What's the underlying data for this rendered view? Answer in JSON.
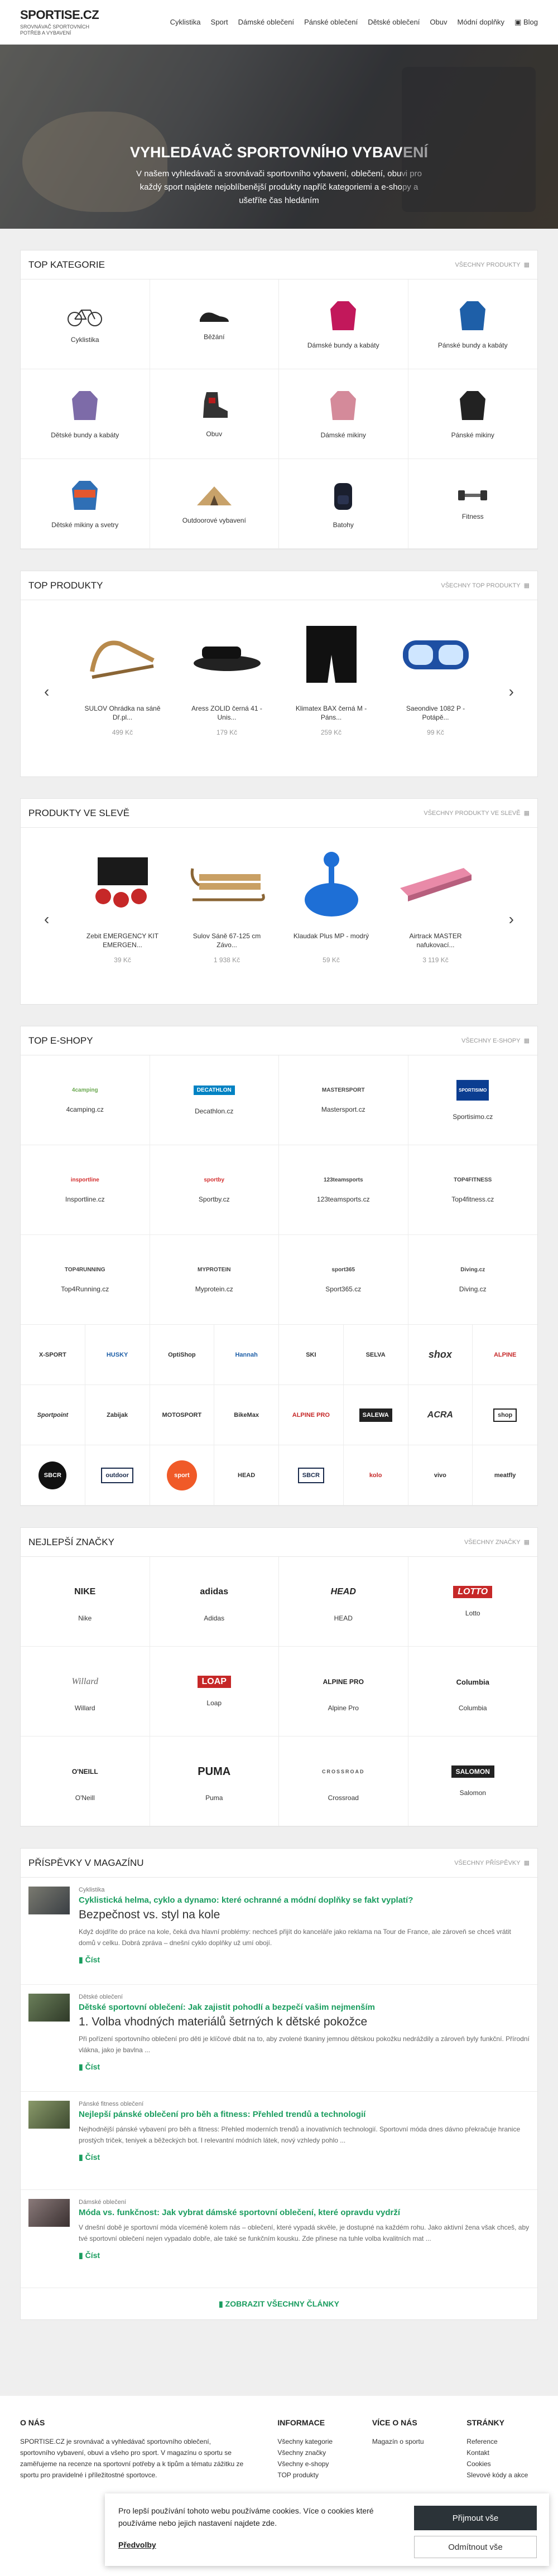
{
  "header": {
    "logo_title": "SPORTISE.CZ",
    "logo_sub_1": "SROVNÁVAČ SPORTOVNÍCH",
    "logo_sub_2": "POTŘEB A VYBAVENÍ",
    "nav": [
      "Cyklistika",
      "Sport",
      "Dámské oblečení",
      "Pánské oblečení",
      "Dětské oblečení",
      "Obuv",
      "Módní doplňky",
      "Blog"
    ]
  },
  "hero": {
    "title": "VYHLEDÁVAČ SPORTOVNÍHO VYBAVENÍ",
    "text": "V našem vyhledávači a srovnávači sportovního vybavení, oblečení, obuvi pro každý sport najdete nejoblíbenější produkty napříč kategoriemi a e-shopy a ušetříte čas hledáním"
  },
  "categories": {
    "title": "TOP KATEGORIE",
    "link": "VŠECHNY PRODUKTY",
    "items": [
      "Cyklistika",
      "Běžání",
      "Dámské bundy a kabáty",
      "Pánské bundy a kabáty",
      "Dětské bundy a kabáty",
      "Obuv",
      "Dámské mikiny",
      "Pánské mikiny",
      "Dětské mikiny a svetry",
      "Outdoorové vybavení",
      "Batohy",
      "Fitness"
    ]
  },
  "top_products": {
    "title": "TOP PRODUKTY",
    "link": "VŠECHNY TOP PRODUKTY",
    "items": [
      {
        "name": "SULOV Ohrádka na sáně Dř.pl...",
        "price": "499 Kč"
      },
      {
        "name": "Aress ZOLID černá 41 - Unis...",
        "price": "179 Kč"
      },
      {
        "name": "Klimatex BAX černá M - Páns...",
        "price": "259 Kč"
      },
      {
        "name": "Saeondive 1082 P - Potápě...",
        "price": "99 Kč"
      }
    ]
  },
  "sale_products": {
    "title": "PRODUKTY VE SLEVĚ",
    "link": "VŠECHNY PRODUKTY VE SLEVĚ",
    "items": [
      {
        "name": "Zebit EMERGENCY KIT EMERGEN...",
        "price": "39 Kč"
      },
      {
        "name": "Sulov Sáně 67-125 cm Závo...",
        "price": "1 938 Kč"
      },
      {
        "name": "Klaudak Plus MP - modrý",
        "price": "59 Kč"
      },
      {
        "name": "Airtrack MASTER nafukovací...",
        "price": "3 119 Kč"
      }
    ]
  },
  "shops": {
    "title": "TOP E-SHOPY",
    "link": "VŠECHNY E-SHOPY",
    "items": [
      {
        "logo": "4camping",
        "name": "4camping.cz"
      },
      {
        "logo": "DECATHLON",
        "name": "Decathlon.cz"
      },
      {
        "logo": "MASTERSPORT",
        "name": "Mastersport.cz"
      },
      {
        "logo": "SPORTISIMO",
        "name": "Sportisimo.cz"
      },
      {
        "logo": "insportline",
        "name": "Insportline.cz"
      },
      {
        "logo": "sportby",
        "name": "Sportby.cz"
      },
      {
        "logo": "123teamsports",
        "name": "123teamsports.cz"
      },
      {
        "logo": "TOP4FITNESS",
        "name": "Top4fitness.cz"
      },
      {
        "logo": "TOP4RUNNING",
        "name": "Top4Running.cz"
      },
      {
        "logo": "MYPROTEIN",
        "name": "Myprotein.cz"
      },
      {
        "logo": "sport365",
        "name": "Sport365.cz"
      },
      {
        "logo": "Diving.cz",
        "name": "Diving.cz"
      }
    ],
    "minis": [
      "X-SPORT",
      "HUSKY",
      "OptiShop",
      "Hannah",
      "SKI",
      "SELVA",
      "shox",
      "ALPINE",
      "Sportpoint",
      "Zabijak",
      "MOTOSPORT",
      "BikeMax",
      "ALPINE PRO",
      "SALEWA",
      "ACRA",
      "shop",
      "SBCR",
      "outdoor",
      "sport",
      "HEAD",
      "SBCR",
      "kolo",
      "vivo",
      "meatfly"
    ]
  },
  "brands": {
    "title": "NEJLEPŠÍ ZNAČKY",
    "link": "VŠECHNY ZNAČKY",
    "items": [
      {
        "logo": "NIKE",
        "name": "Nike"
      },
      {
        "logo": "adidas",
        "name": "Adidas"
      },
      {
        "logo": "HEAD",
        "name": "HEAD"
      },
      {
        "logo": "LOTTO",
        "name": "Lotto"
      },
      {
        "logo": "Willard",
        "name": "Willard"
      },
      {
        "logo": "LOAP",
        "name": "Loap"
      },
      {
        "logo": "ALPINE PRO",
        "name": "Alpine Pro"
      },
      {
        "logo": "Columbia",
        "name": "Columbia"
      },
      {
        "logo": "O'NEILL",
        "name": "O'Neill"
      },
      {
        "logo": "PUMA",
        "name": "Puma"
      },
      {
        "logo": "CROSSROAD",
        "name": "Crossroad"
      },
      {
        "logo": "SALOMON",
        "name": "Salomon"
      }
    ]
  },
  "magazine": {
    "title": "PŘÍSPĚVKY V MAGAZÍNU",
    "link": "VŠECHNY PŘÍSPĚVKY",
    "all_btn": "ZOBRAZIT VŠECHNY ČLÁNKY",
    "items": [
      {
        "cat": "Cyklistika",
        "title": "Cyklistická helma, cyklo a dynamo: které ochranné a módní doplňky se fakt vyplatí?",
        "sub": "Bezpečnost vs. styl na kole",
        "text": "Když dojdříte do práce na kole, čeká dva hlavní problémy: nechceš přijít do kanceláře jako reklama na Tour de France, ale zároveň se chceš vrátit domů v celku. Dobrá zpráva – dnešní cyklo doplňky už umí obojí.",
        "link": "Číst"
      },
      {
        "cat": "Dětské oblečení",
        "title": "Dětské sportovní oblečení: Jak zajistit pohodlí a bezpečí vašim nejmenším",
        "sub": "1. Volba vhodných materiálů šetrných k dětské pokožce",
        "text": "Při pořízení sportovního oblečení pro děti je klíčové dbát na to, aby zvolené tkaniny jemnou dětskou pokožku nedráždily a zároveň byly funkční. Přírodní vlákna, jako je bavlna ...",
        "link": "Číst"
      },
      {
        "cat": "Pánské fitness oblečení",
        "title": "Nejlepší pánské oblečení pro běh a fitness: Přehled trendů a technologií",
        "sub": "",
        "text": "Nejhodnější pánské vybavení pro běh a fitness: Přehled moderních trendů a inovativních technologií. Sportovní móda dnes dávno překračuje hranice prostých triček, teniyek a běžeckých bot. I relevantní módních látek, nový vzhledy pohlo ...",
        "link": "Číst"
      },
      {
        "cat": "Dámské oblečení",
        "title": "Móda vs. funkčnost: Jak vybrat dámské sportovní oblečení, které opravdu vydrží",
        "sub": "",
        "text": "V dnešní době je sportovní móda víceméně kolem nás – oblečení, které vypadá skvěle, je dostupné na každém rohu. Jako aktivní žena však chceš, aby tvé sportovní oblečení nejen vypadalo dobře, ale také se funkčním kousku. Zde přinese na tuhle volba kvalitních mat ...",
        "link": "Číst"
      }
    ]
  },
  "footer": {
    "about_title": "O NÁS",
    "about_text": "SPORTISE.CZ je srovnávač a vyhledávač sportovního oblečení, sportovního vybavení, obuvi a všeho pro sport. V magazínu o sportu se zaměřujeme na recenze na sportovní potřeby a k tipům a tématu zážitku ze sportu pro pravidelné i příležitostné sportovce.",
    "info_title": "INFORMACE",
    "info": [
      "Všechny kategorie",
      "Všechny značky",
      "Všechny e-shopy",
      "TOP produkty"
    ],
    "more_title": "VÍCE O NÁS",
    "more": [
      "Magazín o sportu"
    ],
    "pages_title": "STRÁNKY",
    "pages": [
      "Reference",
      "Kontakt",
      "Cookies",
      "Slevové kódy a akce"
    ]
  },
  "cookie": {
    "text": "Pro lepší používání tohoto webu používáme cookies. Více o cookies které používáme nebo jejich nastavení najdete zde.",
    "link": "Předvolby",
    "accept": "Přijmout vše",
    "reject": "Odmítnout vše"
  }
}
